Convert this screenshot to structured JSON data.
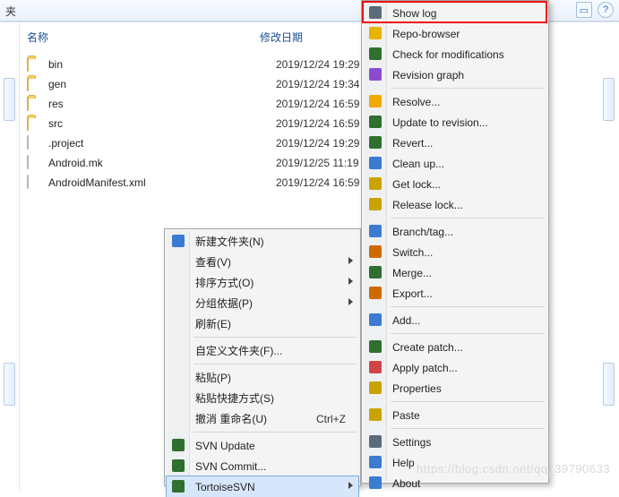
{
  "topbar": {
    "tab_fragment": "夹"
  },
  "columns": {
    "name": "名称",
    "date": "修改日期"
  },
  "files": [
    {
      "name": "bin",
      "date": "2019/12/24 19:29",
      "type": "folder"
    },
    {
      "name": "gen",
      "date": "2019/12/24 19:34",
      "type": "folder"
    },
    {
      "name": "res",
      "date": "2019/12/24 16:59",
      "type": "folder"
    },
    {
      "name": "src",
      "date": "2019/12/24 16:59",
      "type": "folder"
    },
    {
      "name": ".project",
      "date": "2019/12/24 19:29",
      "type": "file"
    },
    {
      "name": "Android.mk",
      "date": "2019/12/25 11:19",
      "type": "file"
    },
    {
      "name": "AndroidManifest.xml",
      "date": "2019/12/24 16:59",
      "type": "file"
    }
  ],
  "ctx": {
    "new_folder": "新建文件夹(N)",
    "view": "查看(V)",
    "sort": "排序方式(O)",
    "group": "分组依据(P)",
    "refresh": "刷新(E)",
    "customize": "自定义文件夹(F)...",
    "paste": "粘贴(P)",
    "paste_shortcut": "粘贴快捷方式(S)",
    "undo_rename": "撤消 重命名(U)",
    "undo_shortcut": "Ctrl+Z",
    "svn_update": "SVN Update",
    "svn_commit": "SVN Commit...",
    "tortoise": "TortoiseSVN"
  },
  "svn": {
    "show_log": "Show log",
    "repo_browser": "Repo-browser",
    "check_mods": "Check for modifications",
    "rev_graph": "Revision graph",
    "resolve": "Resolve...",
    "update_rev": "Update to revision...",
    "revert": "Revert...",
    "cleanup": "Clean up...",
    "get_lock": "Get lock...",
    "release_lock": "Release lock...",
    "branch_tag": "Branch/tag...",
    "switch": "Switch...",
    "merge": "Merge...",
    "export": "Export...",
    "add": "Add...",
    "create_patch": "Create patch...",
    "apply_patch": "Apply patch...",
    "properties": "Properties",
    "paste": "Paste",
    "settings": "Settings",
    "help": "Help",
    "about": "About"
  },
  "icons": {
    "globe": "#3b7bd1",
    "search": "#e8b400",
    "svn": "#2f6f2f",
    "check": "#2f6f2f",
    "graph": "#8a4bd0",
    "resolve": "#f2a900",
    "up": "#2f6f2f",
    "revert": "#2f6f2f",
    "clean": "#3b7bd1",
    "lock": "#c9a400",
    "unlock": "#c9a400",
    "branch": "#3b7bd1",
    "switch": "#d06a00",
    "merge": "#2f6f2f",
    "export": "#d06a00",
    "add": "#3b7bd1",
    "cpatch": "#2f6f2f",
    "apatch": "#d04646",
    "prop": "#c9a400",
    "paste": "#c9a400",
    "settings": "#5a6b7a",
    "help": "#3b7bd1",
    "about": "#3b7bd1",
    "log": "#5a6b7a"
  },
  "watermark": "https://blog.csdn.net/qq_39790633"
}
